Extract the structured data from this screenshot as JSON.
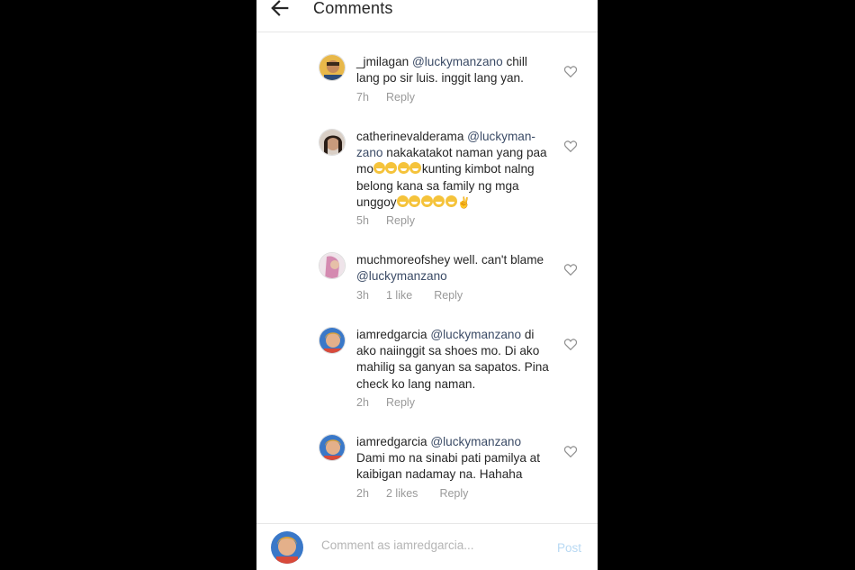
{
  "header": {
    "title": "Comments"
  },
  "comments": [
    {
      "user": "_jmilagan",
      "mention": "@luckymanzano",
      "text_lines": [
        " chill",
        "lang po sir luis. inggit lang yan."
      ],
      "time": "7h",
      "likes": "",
      "reply": "Reply",
      "avatar_color": "#e8b84a"
    },
    {
      "user": "catherinevalderama",
      "mention": "@luckyman-",
      "text_lines": [
        "zano",
        " nakakatakot naman yang paa",
        "mo",
        "kunting kimbot nalng",
        "belong kana sa family ng mga",
        "unggoy",
        "✌"
      ],
      "time": "5h",
      "likes": "",
      "reply": "Reply",
      "avatar_color": "#7a6a5e"
    },
    {
      "user": "muchmoreofshey",
      "mention": "",
      "text_lines": [
        " well. can't blame",
        "@luckymanzano"
      ],
      "time": "3h",
      "likes": "1 like",
      "reply": "Reply",
      "avatar_color": "#c9a0b8"
    },
    {
      "user": "iamredgarcia",
      "mention": "@luckymanzano",
      "text_lines": [
        " di",
        "ako naiinggit sa shoes mo. Di ako",
        "mahilig sa ganyan sa sapatos. Pina",
        "check ko lang naman."
      ],
      "time": "2h",
      "likes": "",
      "reply": "Reply",
      "avatar_color": "#3a78c8"
    },
    {
      "user": "iamredgarcia",
      "mention": "@luckymanzano",
      "text_lines": [
        "Dami mo na sinabi pati pamilya at",
        "kaibigan nadamay na. Hahaha"
      ],
      "time": "2h",
      "likes": "2 likes",
      "reply": "Reply",
      "avatar_color": "#3a78c8"
    }
  ],
  "footer": {
    "placeholder": "Comment as iamredgarcia...",
    "post_label": "Post"
  },
  "icons": {
    "back": "arrow-left-icon",
    "heart": "heart-outline-icon",
    "laughing_emoji": "laughing-emoji-icon",
    "victory_hand": "victory-hand-icon"
  },
  "colors": {
    "text": "#262626",
    "muted": "#999999",
    "mention": "#3b4b66",
    "post_disabled": "#b8d9f3"
  }
}
